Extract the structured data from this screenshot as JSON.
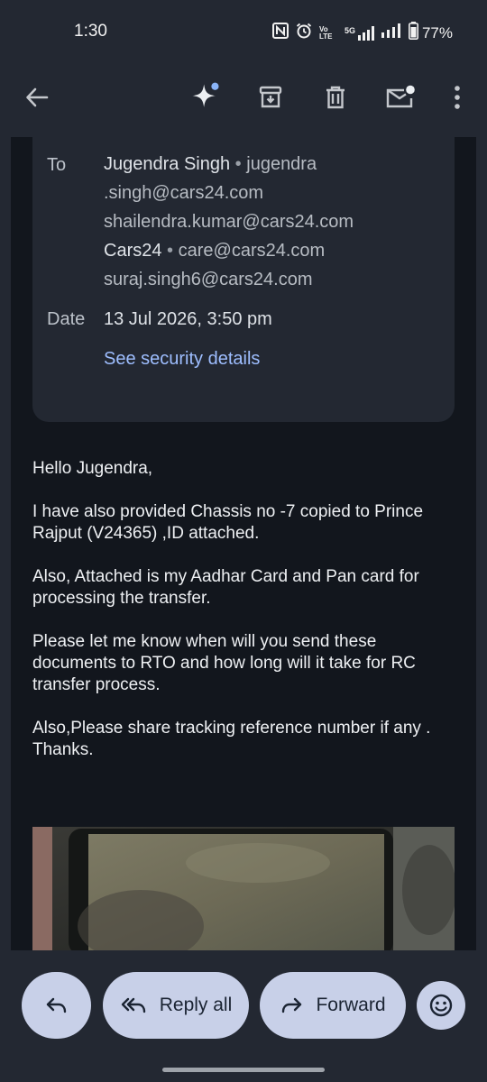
{
  "status_bar": {
    "time": "1:30",
    "network_type": "5G",
    "volte_label": "Vo LTE",
    "battery": "77%"
  },
  "toolbar": {
    "back_icon": "arrow-left-icon",
    "ai_icon": "sparkle-icon",
    "archive_icon": "archive-icon",
    "delete_icon": "trash-icon",
    "unread_icon": "mail-unread-icon",
    "more_icon": "more-vert-icon"
  },
  "details": {
    "to_label": "To",
    "recipients": [
      {
        "name": "Jugendra Singh",
        "email_line1": "jugendra",
        "email_line2": ".singh@cars24.com"
      },
      {
        "email": "shailendra.kumar@cars24.com"
      },
      {
        "name": "Cars24",
        "email": "care@cars24.com"
      },
      {
        "email": "suraj.singh6@cars24.com"
      }
    ],
    "separator": "•",
    "date_label": "Date",
    "date_value": "13 Jul 2026, 3:50 pm",
    "security_link": "See security details"
  },
  "message": {
    "greeting": "Hello Jugendra,",
    "para1": "I have also provided Chassis no -7 copied to Prince Rajput (V24365) ,ID attached.",
    "para2": "Also, Attached is my Aadhar Card and Pan card for processing the transfer.",
    "para3": "Please let me know when will you send these documents to RTO and how long will it take for RC transfer process.",
    "para4": "Also,Please share tracking reference number if any . Thanks."
  },
  "actions": {
    "reply_icon": "reply-icon",
    "reply_all_label": "Reply all",
    "forward_label": "Forward",
    "emoji_icon": "emoji-icon"
  },
  "colors": {
    "background": "#232832",
    "content_bg": "#12161d",
    "link": "#9ebeff",
    "pill": "#c8d0e8",
    "sparkle_dot": "#8ab4f8"
  }
}
